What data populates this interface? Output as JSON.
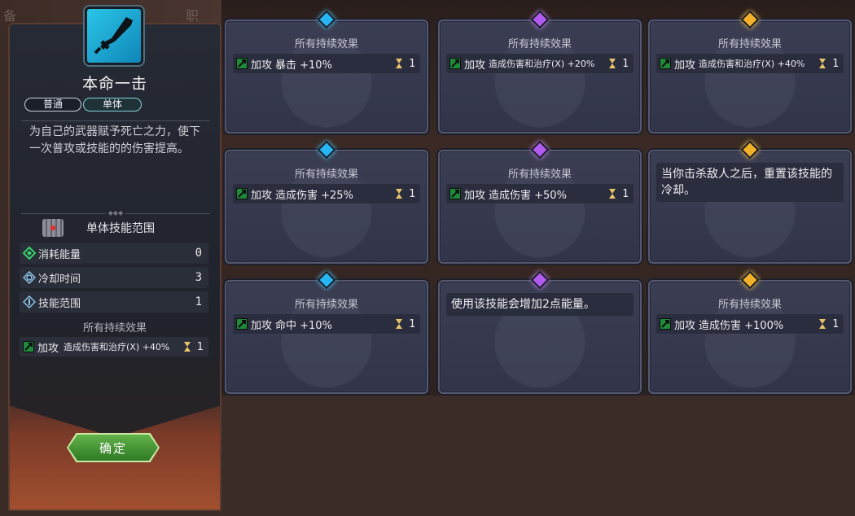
{
  "background": {
    "ghost_left": "备",
    "ghost_right": "职"
  },
  "skill": {
    "title": "本命一击",
    "tags": [
      "普通",
      "单体"
    ],
    "description": "为自己的武器赋予死亡之力，使下一次普攻或技能的的伤害提高。",
    "range_label": "单体技能范围",
    "stats": [
      {
        "icon": "energy-icon",
        "label": "消耗能量",
        "value": "0",
        "color": "#37d46a"
      },
      {
        "icon": "cooldown-icon",
        "label": "冷却时间",
        "value": "3",
        "color": "#8ec5e8"
      },
      {
        "icon": "range-icon",
        "label": "技能范围",
        "value": "1",
        "color": "#8ec5e8"
      }
    ],
    "effects_title": "所有持续效果",
    "effect": {
      "type": "加攻",
      "text": "造成伤害和治疗(X) +40%",
      "duration": "1"
    },
    "confirm_label": "确定"
  },
  "cards": [
    {
      "gem": "blue",
      "title": "所有持续效果",
      "effect": {
        "type": "加攻",
        "text": "暴击 +10%",
        "duration": "1"
      }
    },
    {
      "gem": "purple",
      "title": "所有持续效果",
      "effect": {
        "type": "加攻",
        "text": "造成伤害和治疗(X) +20%",
        "duration": "1"
      }
    },
    {
      "gem": "gold",
      "title": "所有持续效果",
      "effect": {
        "type": "加攻",
        "text": "造成伤害和治疗(X) +40%",
        "duration": "1"
      }
    },
    {
      "gem": "blue",
      "title": "所有持续效果",
      "effect": {
        "type": "加攻",
        "text": "造成伤害 +25%",
        "duration": "1"
      }
    },
    {
      "gem": "purple",
      "title": "所有持续效果",
      "effect": {
        "type": "加攻",
        "text": "造成伤害 +50%",
        "duration": "1"
      }
    },
    {
      "gem": "gold",
      "text": "当你击杀敌人之后，重置该技能的冷却。"
    },
    {
      "gem": "blue",
      "title": "所有持续效果",
      "effect": {
        "type": "加攻",
        "text": "命中 +10%",
        "duration": "1"
      }
    },
    {
      "gem": "purple",
      "text": "使用该技能会增加2点能量。"
    },
    {
      "gem": "gold",
      "title": "所有持续效果",
      "effect": {
        "type": "加攻",
        "text": "造成伤害 +100%",
        "duration": "1"
      }
    }
  ],
  "colors": {
    "gem_blue": "#27b6f5",
    "gem_purple": "#b25bf0",
    "gem_gold": "#f3b12a",
    "attack_icon": "#1e8a3a",
    "hourglass": "#e8c46a",
    "confirm": "#4d9c38"
  }
}
